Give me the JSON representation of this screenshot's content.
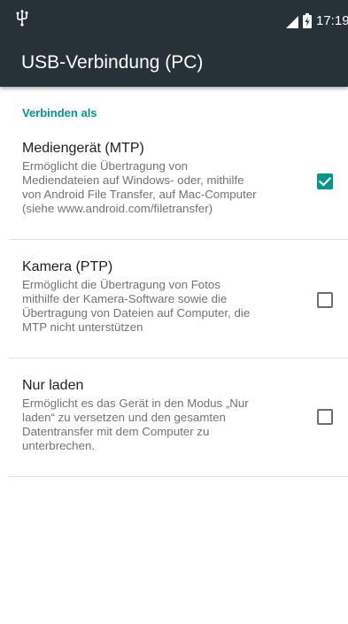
{
  "status_bar": {
    "time": "17:19",
    "icons": [
      "usb-icon",
      "signal-icon",
      "battery-charging-icon"
    ]
  },
  "app_bar": {
    "title": "USB-Verbindung (PC)",
    "background": "#263238"
  },
  "section": {
    "header": "Verbinden als",
    "accent": "#009688"
  },
  "options": [
    {
      "title": "Mediengerät (MTP)",
      "summary": "Ermöglicht die Übertragung von\nMediendateien auf Windows- oder, mithilfe\nvon Android File Transfer, auf Mac-Computer\n(siehe www.android.com/filetransfer)",
      "checked": true
    },
    {
      "title": "Kamera (PTP)",
      "summary": "Ermöglicht die Übertragung von Fotos\nmithilfe der Kamera-Software sowie die\nÜbertragung von Dateien auf Computer, die\nMTP nicht unterstützen",
      "checked": false
    },
    {
      "title": "Nur laden",
      "summary": "Ermöglicht es das Gerät in den Modus „Nur\nladen“ zu versetzen und den gesamten\nDatentransfer mit dem Computer zu\nunterbrechen.",
      "checked": false
    }
  ]
}
